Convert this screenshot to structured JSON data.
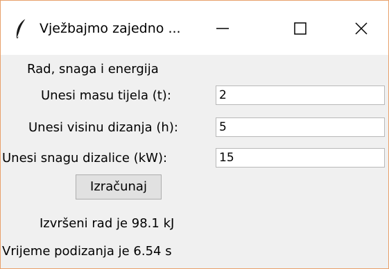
{
  "window": {
    "title": "Vježbajmo zajedno ...",
    "buttons": {
      "minimize": "minimize-icon",
      "maximize": "maximize-icon",
      "close": "close-icon"
    },
    "accent_border": "#e8a06a"
  },
  "form": {
    "heading": "Rad, snaga i energija",
    "mass_label": "Unesi masu tijela (t):",
    "mass_value": "2",
    "height_label": "Unesi visinu dizanja (h):",
    "height_value": "5",
    "power_label": "Unesi snagu dizalice (kW):",
    "power_value": "15",
    "calculate_label": "Izračunaj"
  },
  "results": {
    "work": "Izvršeni rad je 98.1 kJ",
    "time": "Vrijeme podizanja je 6.54 s"
  }
}
